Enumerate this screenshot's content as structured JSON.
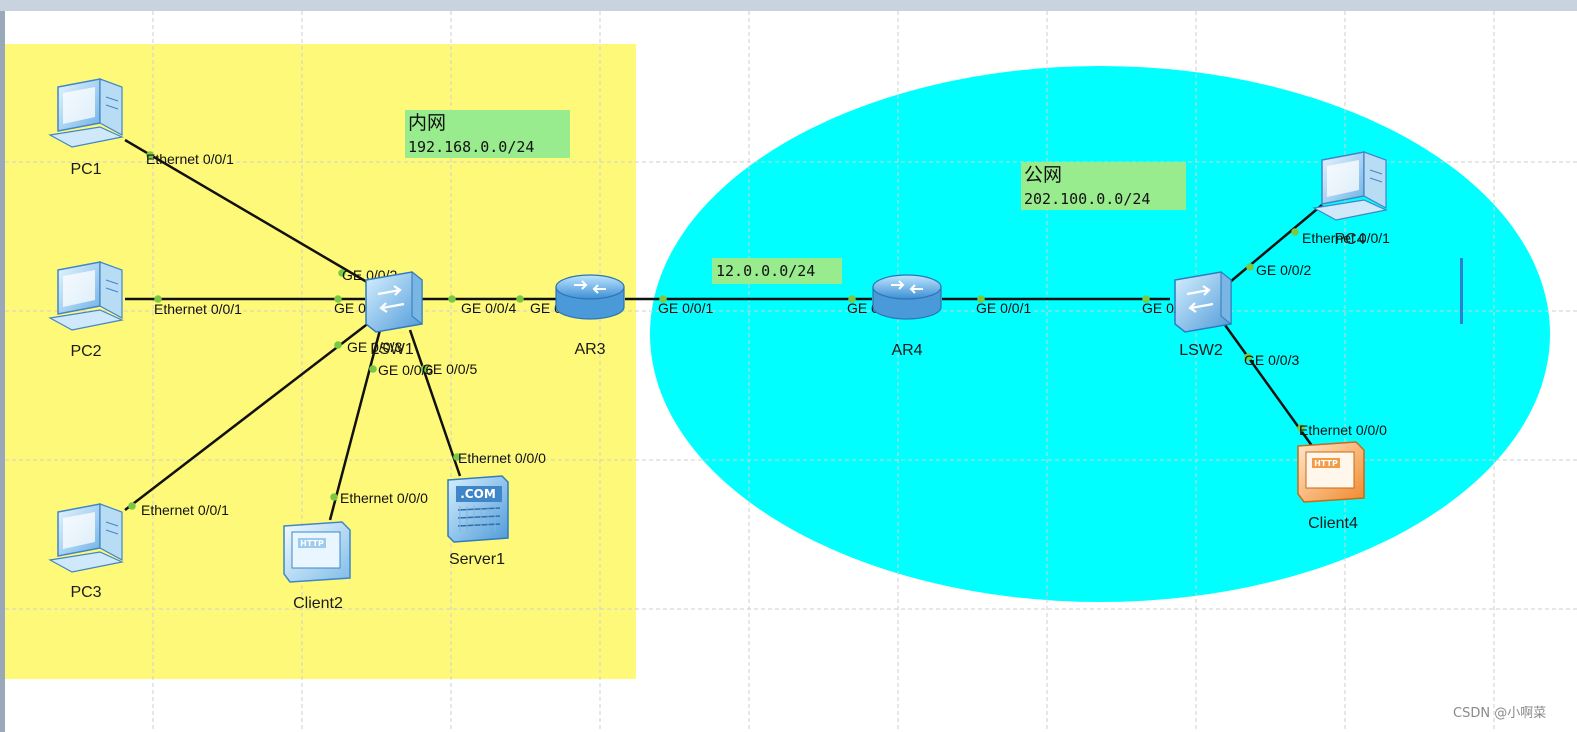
{
  "colors": {
    "intranet_area": "#fff97a",
    "public_area": "#00ffff",
    "note_bg": "#98ec8e",
    "link": "#111111",
    "port_dot": "#7ac943",
    "grid": "#cfcfcf",
    "titlebar": "#c9d3df"
  },
  "areas": {
    "intranet": {
      "title": "内网",
      "subnet": "192.168.0.0/24"
    },
    "public": {
      "title": "公网",
      "subnet": "202.100.0.0/24"
    },
    "wan_link": {
      "subnet": "12.0.0.0/24"
    }
  },
  "devices": [
    {
      "id": "pc1",
      "label": "PC1",
      "icon": "pc-icon"
    },
    {
      "id": "pc2",
      "label": "PC2",
      "icon": "pc-icon"
    },
    {
      "id": "pc3",
      "label": "PC3",
      "icon": "pc-icon"
    },
    {
      "id": "lsw1",
      "label": "LSW1",
      "icon": "switch-icon"
    },
    {
      "id": "client2",
      "label": "Client2",
      "icon": "http-client-icon"
    },
    {
      "id": "server1",
      "label": "Server1",
      "icon": "server-icon"
    },
    {
      "id": "ar3",
      "label": "AR3",
      "icon": "router-icon"
    },
    {
      "id": "ar4",
      "label": "AR4",
      "icon": "router-icon"
    },
    {
      "id": "lsw2",
      "label": "LSW2",
      "icon": "switch-icon"
    },
    {
      "id": "pc4",
      "label": "PC4",
      "icon": "pc-icon"
    },
    {
      "id": "client4",
      "label": "Client4",
      "icon": "http-client-icon"
    }
  ],
  "links": [
    {
      "from": "pc1",
      "from_port": "Ethernet 0/0/1",
      "to": "lsw1",
      "to_port": "GE 0/0/2"
    },
    {
      "from": "pc2",
      "from_port": "Ethernet 0/0/1",
      "to": "lsw1",
      "to_port": "GE 0/0/1"
    },
    {
      "from": "pc3",
      "from_port": "Ethernet 0/0/1",
      "to": "lsw1",
      "to_port": "GE 0/0/3"
    },
    {
      "from": "client2",
      "from_port": "Ethernet 0/0/0",
      "to": "lsw1",
      "to_port": "GE 0/0/6"
    },
    {
      "from": "server1",
      "from_port": "Ethernet 0/0/0",
      "to": "lsw1",
      "to_port": "GE 0/0/5"
    },
    {
      "from": "lsw1",
      "from_port": "GE 0/0/4",
      "to": "ar3",
      "to_port": "GE 0/0/0"
    },
    {
      "from": "ar3",
      "from_port": "GE 0/0/1",
      "to": "ar4",
      "to_port": "GE 0/0/0"
    },
    {
      "from": "ar4",
      "from_port": "GE 0/0/1",
      "to": "lsw2",
      "to_port": "GE 0/0/1"
    },
    {
      "from": "lsw2",
      "from_port": "GE 0/0/2",
      "to": "pc4",
      "to_port": "Ethernet 0/0/1"
    },
    {
      "from": "lsw2",
      "from_port": "GE 0/0/3",
      "to": "client4",
      "to_port": "Ethernet 0/0/0"
    }
  ],
  "watermark": "CSDN @小啊菜"
}
